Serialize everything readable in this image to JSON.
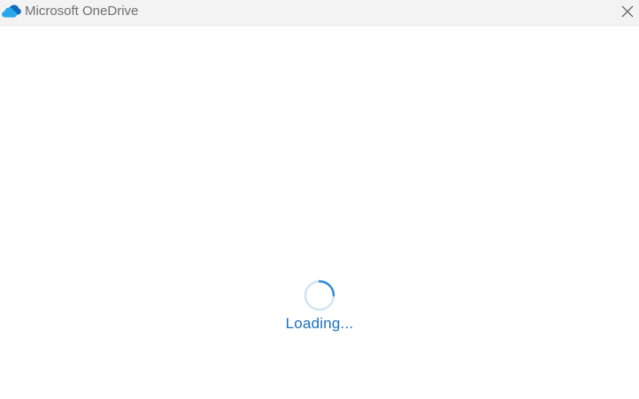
{
  "window": {
    "title": "Microsoft OneDrive",
    "app_icon": "onedrive-cloud-icon",
    "close_icon": "close-icon"
  },
  "loader": {
    "text": "Loading...",
    "spinner_icon": "spinner-icon"
  },
  "colors": {
    "titlebar_bg": "#f3f3f3",
    "title_text": "#707070",
    "accent": "#1a6fc0",
    "spinner_track": "#cfe3f5",
    "spinner_arc": "#2b88d8",
    "cloud_blue": "#0f6cbd",
    "cloud_light": "#28a8ea"
  }
}
